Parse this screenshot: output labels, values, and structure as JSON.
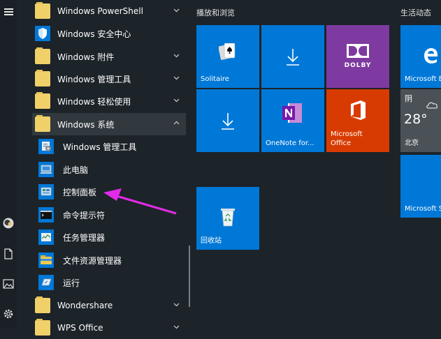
{
  "app_list": {
    "items": [
      {
        "label": "Windows PowerShell",
        "icon": "folder-icon",
        "chevron": "down"
      },
      {
        "label": "Windows 安全中心",
        "icon": "shield-icon"
      },
      {
        "label": "Windows 附件",
        "icon": "folder-icon",
        "chevron": "down"
      },
      {
        "label": "Windows 管理工具",
        "icon": "folder-icon",
        "chevron": "down"
      },
      {
        "label": "Windows 轻松使用",
        "icon": "folder-icon",
        "chevron": "down"
      },
      {
        "label": "Windows 系统",
        "icon": "folder-icon",
        "chevron": "up",
        "expanded": true
      },
      {
        "label": "Windows 管理工具",
        "icon": "admin-tools-icon"
      },
      {
        "label": "此电脑",
        "icon": "this-pc-icon"
      },
      {
        "label": "控制面板",
        "icon": "control-panel-icon"
      },
      {
        "label": "命令提示符",
        "icon": "cmd-icon"
      },
      {
        "label": "任务管理器",
        "icon": "task-manager-icon"
      },
      {
        "label": "文件资源管理器",
        "icon": "file-explorer-icon"
      },
      {
        "label": "运行",
        "icon": "run-icon"
      },
      {
        "label": "Wondershare",
        "icon": "folder-icon",
        "chevron": "down"
      },
      {
        "label": "WPS Office",
        "icon": "folder-icon",
        "chevron": "down"
      }
    ]
  },
  "groups": {
    "play": "播放和浏览",
    "life": "生活动态"
  },
  "tiles": {
    "solitaire": "Solitaire",
    "onenote": "OneNote for...",
    "office_line1": "Microsoft",
    "office_line2": "Office",
    "dolby": "DOLBY",
    "recycle": "回收站",
    "edge": "Microsoft E",
    "store": "Microsoft S"
  },
  "weather": {
    "condition": "阴",
    "temp": "28°",
    "city": "北京"
  },
  "colors": {
    "tile_blue": "#0078d7",
    "dolby_purple": "#7e3aa0",
    "office_orange": "#d83b01",
    "annotation_arrow": "#e22be6",
    "folder_yellow": "#f1d06a"
  }
}
